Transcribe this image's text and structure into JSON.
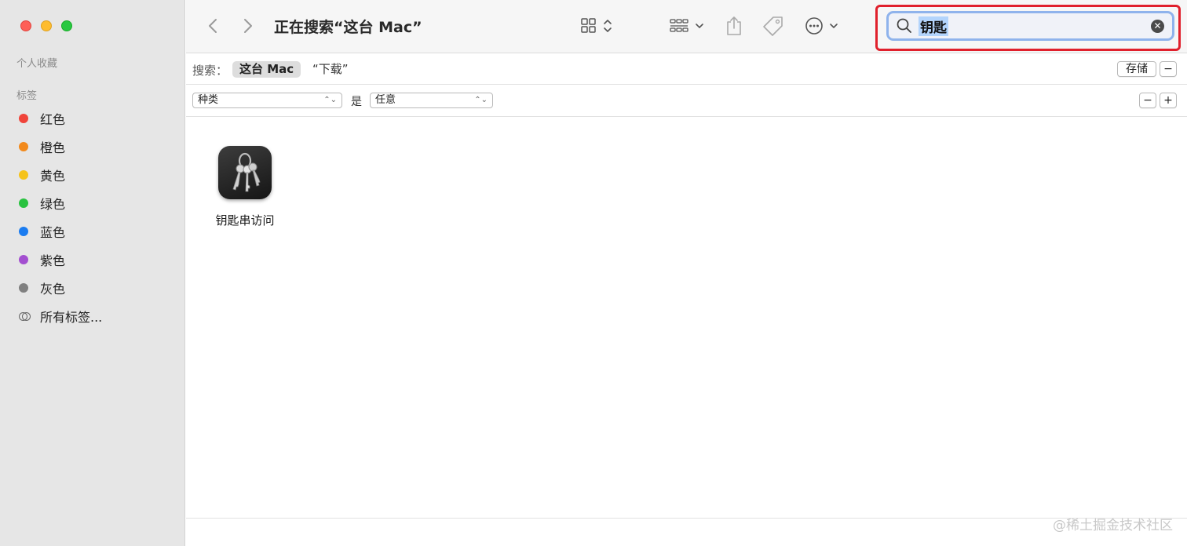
{
  "window": {
    "title": "正在搜索“这台 Mac”"
  },
  "sidebar": {
    "favorites_title": "个人收藏",
    "tags_title": "标签",
    "tags": [
      {
        "label": "红色",
        "color": "#f0443a"
      },
      {
        "label": "橙色",
        "color": "#f28a1c"
      },
      {
        "label": "黄色",
        "color": "#f5c31a"
      },
      {
        "label": "绿色",
        "color": "#29c240"
      },
      {
        "label": "蓝色",
        "color": "#1b7cf0"
      },
      {
        "label": "紫色",
        "color": "#a34fd0"
      },
      {
        "label": "灰色",
        "color": "#808080"
      }
    ],
    "all_tags_label": "所有标签..."
  },
  "toolbar": {
    "back_icon": "chevron-left-icon",
    "forward_icon": "chevron-right-icon",
    "view_icon": "grid-view-icon",
    "group_icon": "group-by-icon",
    "share_icon": "share-icon",
    "tag_icon": "tag-icon",
    "more_icon": "ellipsis-circle-icon"
  },
  "search": {
    "value": "钥匙",
    "highlight_color": "#e0202c"
  },
  "scope": {
    "label": "搜索：",
    "this_mac": "这台 Mac",
    "downloads": "“下载”",
    "save_label": "存储",
    "remove_label": "−"
  },
  "criteria": {
    "kind_label": "种类",
    "is_label": "是",
    "any_label": "任意",
    "remove_label": "−",
    "add_label": "+"
  },
  "results": [
    {
      "name": "钥匙串访问",
      "icon": "keychain-access-icon"
    }
  ],
  "watermark": "@稀土掘金技术社区"
}
